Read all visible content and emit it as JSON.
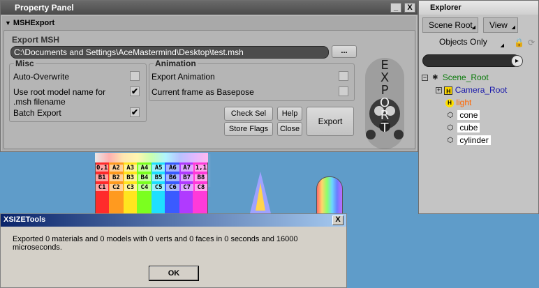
{
  "property_panel": {
    "title": "Property Panel",
    "minimize_label": "_",
    "close_label": "X",
    "section_title": "MSHExport",
    "export_msh_label": "Export MSH",
    "path_value": "C:\\Documents and Settings\\AceMastermind\\Desktop\\test.msh",
    "browse_label": "...",
    "misc": {
      "title": "Misc",
      "auto_overwrite": "Auto-Overwrite",
      "auto_overwrite_checked": false,
      "use_root_name": "Use root model name for .msh filename",
      "use_root_name_checked": true,
      "batch_export": "Batch Export",
      "batch_export_checked": true
    },
    "animation": {
      "title": "Animation",
      "export_animation": "Export Animation",
      "export_animation_checked": false,
      "current_frame": "Current frame as Basepose",
      "current_frame_checked": false
    },
    "buttons": {
      "check_sel": "Check Sel",
      "help": "Help",
      "store_flags": "Store Flags",
      "close": "Close",
      "export": "Export"
    },
    "logo_letters": [
      "E",
      "X",
      "P",
      "O",
      "R",
      "T"
    ]
  },
  "explorer": {
    "title": "Explorer",
    "scene_root_tab": "Scene Root",
    "view_tab": "View",
    "objects_only_tab": "Objects Only",
    "tree": [
      {
        "label": "Scene_Root",
        "color": "#0a7a0a"
      },
      {
        "label": "Camera_Root",
        "color": "#1a1aaa"
      },
      {
        "label": "light",
        "color": "#ff6600"
      },
      {
        "label": "cone",
        "color": "#000000"
      },
      {
        "label": "cube",
        "color": "#000000"
      },
      {
        "label": "cylinder",
        "color": "#000000"
      }
    ]
  },
  "viewport": {
    "cube_labels": [
      "0,1",
      "A2",
      "A3",
      "A4",
      "A5",
      "A6",
      "A7",
      "1,1",
      "B1",
      "B2",
      "B3",
      "B4",
      "B5",
      "B6",
      "B7",
      "B8",
      "C1",
      "C2",
      "C3",
      "C4",
      "C5",
      "C6",
      "C7",
      "C8"
    ]
  },
  "dialog": {
    "title": "XSIZETools",
    "close_label": "X",
    "message": "Exported 0 materials and 0 models with 0 verts and 0 faces in 0 seconds and 16000 microseconds.",
    "ok_label": "OK"
  },
  "colors": {
    "viewport_bg": "#5f9cc9",
    "panel_bg": "#a9a9a9",
    "dialog_title": "#0a246a"
  }
}
